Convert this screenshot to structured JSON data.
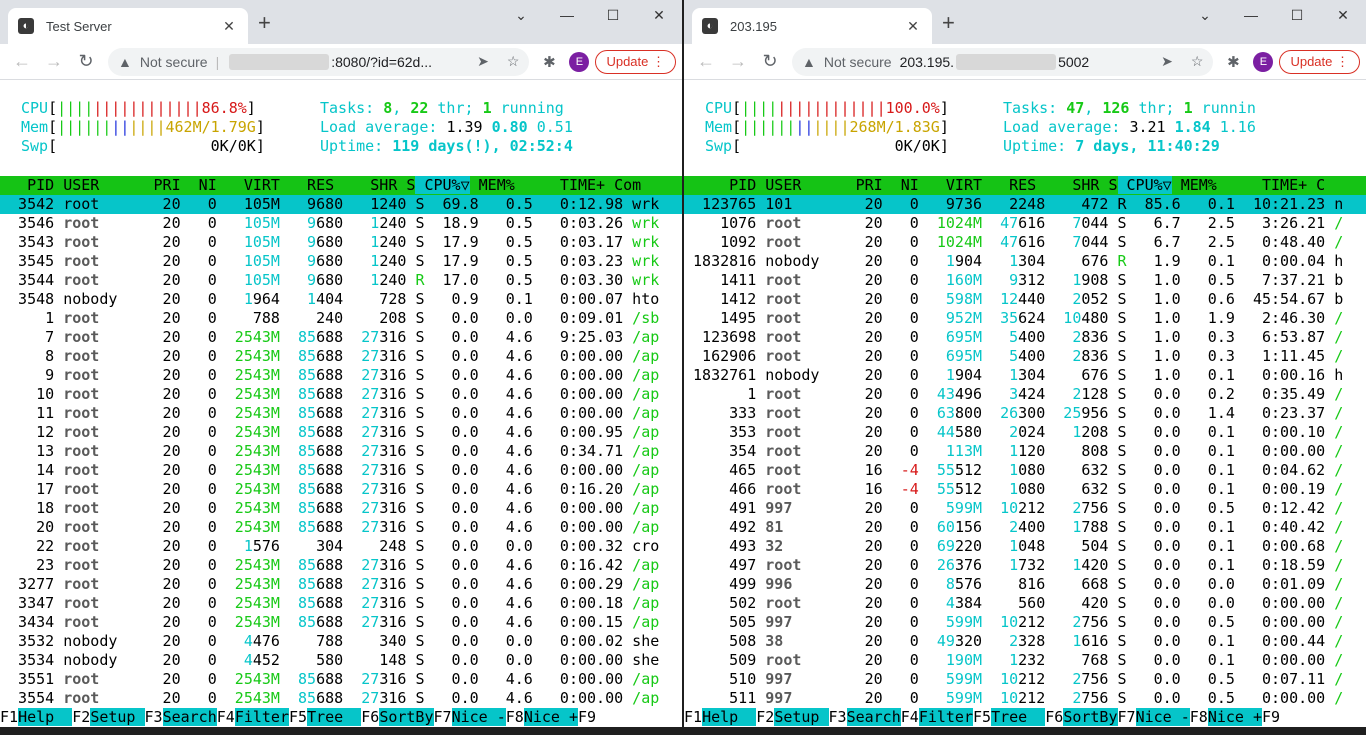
{
  "windows": [
    {
      "tab_title": "Test Server",
      "url_suffix": ":8080/?id=62d...",
      "not_secure": "Not secure",
      "update_label": "Update",
      "avatar": "E",
      "meters": {
        "cpu_label": "CPU",
        "cpu_bar": "||||||||||||||||",
        "cpu_val": "86.8%",
        "mem_label": "Mem",
        "mem_bar": "||||||||||||",
        "mem_val": "462M/1.79G",
        "swp_label": "Swp",
        "swp_val": "0K/0K",
        "tasks": "Tasks: ",
        "tasks_n": "8",
        "thr_n": "22",
        "running_n": "1",
        "tasks_rest": " thr; ",
        "running_word": " running",
        "load_label": "Load average: ",
        "load1": "1.39",
        "load5": "0.80",
        "load15": "0.51",
        "uptime_label": "Uptime: ",
        "uptime_val": "119 days(!), 02:52:4"
      },
      "columns": [
        "  PID",
        "USER     ",
        "  PRI",
        "  NI",
        "  VIRT",
        "   RES",
        "   SHR",
        "S",
        "CPU%▽",
        "MEM%",
        "   TIME+  ",
        "Com"
      ],
      "rows": [
        [
          "3542",
          "root",
          "20",
          "0",
          "105M",
          "9680",
          "1240",
          "S",
          "69.8",
          "0.5",
          "0:12.98",
          "wrk"
        ],
        [
          "3546",
          "root",
          "20",
          "0",
          "105M",
          "9680",
          "1240",
          "S",
          "18.9",
          "0.5",
          "0:03.26",
          "wrk"
        ],
        [
          "3543",
          "root",
          "20",
          "0",
          "105M",
          "9680",
          "1240",
          "S",
          "17.9",
          "0.5",
          "0:03.17",
          "wrk"
        ],
        [
          "3545",
          "root",
          "20",
          "0",
          "105M",
          "9680",
          "1240",
          "S",
          "17.9",
          "0.5",
          "0:03.23",
          "wrk"
        ],
        [
          "3544",
          "root",
          "20",
          "0",
          "105M",
          "9680",
          "1240",
          "R",
          "17.0",
          "0.5",
          "0:03.30",
          "wrk"
        ],
        [
          "3548",
          "nobody",
          "20",
          "0",
          "1964",
          "1404",
          "728",
          "S",
          "0.9",
          "0.1",
          "0:00.07",
          "hto"
        ],
        [
          "1",
          "root",
          "20",
          "0",
          "788",
          "240",
          "208",
          "S",
          "0.0",
          "0.0",
          "0:09.01",
          "/sb"
        ],
        [
          "7",
          "root",
          "20",
          "0",
          "2543M",
          "85688",
          "27316",
          "S",
          "0.0",
          "4.6",
          "9:25.03",
          "/ap"
        ],
        [
          "8",
          "root",
          "20",
          "0",
          "2543M",
          "85688",
          "27316",
          "S",
          "0.0",
          "4.6",
          "0:00.00",
          "/ap"
        ],
        [
          "9",
          "root",
          "20",
          "0",
          "2543M",
          "85688",
          "27316",
          "S",
          "0.0",
          "4.6",
          "0:00.00",
          "/ap"
        ],
        [
          "10",
          "root",
          "20",
          "0",
          "2543M",
          "85688",
          "27316",
          "S",
          "0.0",
          "4.6",
          "0:00.00",
          "/ap"
        ],
        [
          "11",
          "root",
          "20",
          "0",
          "2543M",
          "85688",
          "27316",
          "S",
          "0.0",
          "4.6",
          "0:00.00",
          "/ap"
        ],
        [
          "12",
          "root",
          "20",
          "0",
          "2543M",
          "85688",
          "27316",
          "S",
          "0.0",
          "4.6",
          "0:00.95",
          "/ap"
        ],
        [
          "13",
          "root",
          "20",
          "0",
          "2543M",
          "85688",
          "27316",
          "S",
          "0.0",
          "4.6",
          "0:34.71",
          "/ap"
        ],
        [
          "14",
          "root",
          "20",
          "0",
          "2543M",
          "85688",
          "27316",
          "S",
          "0.0",
          "4.6",
          "0:00.00",
          "/ap"
        ],
        [
          "17",
          "root",
          "20",
          "0",
          "2543M",
          "85688",
          "27316",
          "S",
          "0.0",
          "4.6",
          "0:16.20",
          "/ap"
        ],
        [
          "18",
          "root",
          "20",
          "0",
          "2543M",
          "85688",
          "27316",
          "S",
          "0.0",
          "4.6",
          "0:00.00",
          "/ap"
        ],
        [
          "20",
          "root",
          "20",
          "0",
          "2543M",
          "85688",
          "27316",
          "S",
          "0.0",
          "4.6",
          "0:00.00",
          "/ap"
        ],
        [
          "22",
          "root",
          "20",
          "0",
          "1576",
          "304",
          "248",
          "S",
          "0.0",
          "0.0",
          "0:00.32",
          "cro"
        ],
        [
          "23",
          "root",
          "20",
          "0",
          "2543M",
          "85688",
          "27316",
          "S",
          "0.0",
          "4.6",
          "0:16.42",
          "/ap"
        ],
        [
          "3277",
          "root",
          "20",
          "0",
          "2543M",
          "85688",
          "27316",
          "S",
          "0.0",
          "4.6",
          "0:00.29",
          "/ap"
        ],
        [
          "3347",
          "root",
          "20",
          "0",
          "2543M",
          "85688",
          "27316",
          "S",
          "0.0",
          "4.6",
          "0:00.18",
          "/ap"
        ],
        [
          "3434",
          "root",
          "20",
          "0",
          "2543M",
          "85688",
          "27316",
          "S",
          "0.0",
          "4.6",
          "0:00.15",
          "/ap"
        ],
        [
          "3532",
          "nobody",
          "20",
          "0",
          "4476",
          "788",
          "340",
          "S",
          "0.0",
          "0.0",
          "0:00.02",
          "she"
        ],
        [
          "3534",
          "nobody",
          "20",
          "0",
          "4452",
          "580",
          "148",
          "S",
          "0.0",
          "0.0",
          "0:00.00",
          "she"
        ],
        [
          "3551",
          "root",
          "20",
          "0",
          "2543M",
          "85688",
          "27316",
          "S",
          "0.0",
          "4.6",
          "0:00.00",
          "/ap"
        ],
        [
          "3554",
          "root",
          "20",
          "0",
          "2543M",
          "85688",
          "27316",
          "S",
          "0.0",
          "4.6",
          "0:00.00",
          "/ap"
        ]
      ]
    },
    {
      "tab_title": "203.195",
      "url_suffix": "5002",
      "url_prefix": "203.195.",
      "not_secure": "Not secure",
      "update_label": "Update",
      "avatar": "E",
      "meters": {
        "cpu_label": "CPU",
        "cpu_bar": "||||||||||||||||",
        "cpu_val": "100.0%",
        "mem_label": "Mem",
        "mem_bar": "||||||||||||",
        "mem_val": "268M/1.83G",
        "swp_label": "Swp",
        "swp_val": "0K/0K",
        "tasks": "Tasks: ",
        "tasks_n": "47",
        "thr_n": "126",
        "running_n": "1",
        "tasks_rest": " thr; ",
        "running_word": " runnin",
        "load_label": "Load average: ",
        "load1": "3.21",
        "load5": "1.84",
        "load15": "1.16",
        "uptime_label": "Uptime: ",
        "uptime_val": "7 days, 11:40:29"
      },
      "columns": [
        "    PID",
        "USER     ",
        "  PRI",
        "  NI",
        "  VIRT",
        "   RES",
        "   SHR",
        "S",
        "CPU%▽",
        "MEM%",
        "   TIME+  ",
        "C"
      ],
      "rows": [
        [
          "123765",
          "101",
          "20",
          "0",
          "9736",
          "2248",
          "472",
          "R",
          "85.6",
          "0.1",
          "10:21.23",
          "n"
        ],
        [
          "1076",
          "root",
          "20",
          "0",
          "1024M",
          "47616",
          "7044",
          "S",
          "6.7",
          "2.5",
          "3:26.21",
          "/"
        ],
        [
          "1092",
          "root",
          "20",
          "0",
          "1024M",
          "47616",
          "7044",
          "S",
          "6.7",
          "2.5",
          "0:48.40",
          "/"
        ],
        [
          "1832816",
          "nobody",
          "20",
          "0",
          "1904",
          "1304",
          "676",
          "R",
          "1.9",
          "0.1",
          "0:00.04",
          "h"
        ],
        [
          "1411",
          "root",
          "20",
          "0",
          "160M",
          "9312",
          "1908",
          "S",
          "1.0",
          "0.5",
          "7:37.21",
          "b"
        ],
        [
          "1412",
          "root",
          "20",
          "0",
          "598M",
          "12440",
          "2052",
          "S",
          "1.0",
          "0.6",
          "45:54.67",
          "b"
        ],
        [
          "1495",
          "root",
          "20",
          "0",
          "952M",
          "35624",
          "10480",
          "S",
          "1.0",
          "1.9",
          "2:46.30",
          "/"
        ],
        [
          "123698",
          "root",
          "20",
          "0",
          "695M",
          "5400",
          "2836",
          "S",
          "1.0",
          "0.3",
          "6:53.87",
          "/"
        ],
        [
          "162906",
          "root",
          "20",
          "0",
          "695M",
          "5400",
          "2836",
          "S",
          "1.0",
          "0.3",
          "1:11.45",
          "/"
        ],
        [
          "1832761",
          "nobody",
          "20",
          "0",
          "1904",
          "1304",
          "676",
          "S",
          "1.0",
          "0.1",
          "0:00.16",
          "h"
        ],
        [
          "1",
          "root",
          "20",
          "0",
          "43496",
          "3424",
          "2128",
          "S",
          "0.0",
          "0.2",
          "0:35.49",
          "/"
        ],
        [
          "333",
          "root",
          "20",
          "0",
          "63800",
          "26300",
          "25956",
          "S",
          "0.0",
          "1.4",
          "0:23.37",
          "/"
        ],
        [
          "353",
          "root",
          "20",
          "0",
          "44580",
          "2024",
          "1208",
          "S",
          "0.0",
          "0.1",
          "0:00.10",
          "/"
        ],
        [
          "354",
          "root",
          "20",
          "0",
          "113M",
          "1120",
          "808",
          "S",
          "0.0",
          "0.1",
          "0:00.00",
          "/"
        ],
        [
          "465",
          "root",
          "16",
          "-4",
          "55512",
          "1080",
          "632",
          "S",
          "0.0",
          "0.1",
          "0:04.62",
          "/"
        ],
        [
          "466",
          "root",
          "16",
          "-4",
          "55512",
          "1080",
          "632",
          "S",
          "0.0",
          "0.1",
          "0:00.19",
          "/"
        ],
        [
          "491",
          "997",
          "20",
          "0",
          "599M",
          "10212",
          "2756",
          "S",
          "0.0",
          "0.5",
          "0:12.42",
          "/"
        ],
        [
          "492",
          "81",
          "20",
          "0",
          "60156",
          "2400",
          "1788",
          "S",
          "0.0",
          "0.1",
          "0:40.42",
          "/"
        ],
        [
          "493",
          "32",
          "20",
          "0",
          "69220",
          "1048",
          "504",
          "S",
          "0.0",
          "0.1",
          "0:00.68",
          "/"
        ],
        [
          "497",
          "root",
          "20",
          "0",
          "26376",
          "1732",
          "1420",
          "S",
          "0.0",
          "0.1",
          "0:18.59",
          "/"
        ],
        [
          "499",
          "996",
          "20",
          "0",
          "8576",
          "816",
          "668",
          "S",
          "0.0",
          "0.0",
          "0:01.09",
          "/"
        ],
        [
          "502",
          "root",
          "20",
          "0",
          "4384",
          "560",
          "420",
          "S",
          "0.0",
          "0.0",
          "0:00.00",
          "/"
        ],
        [
          "505",
          "997",
          "20",
          "0",
          "599M",
          "10212",
          "2756",
          "S",
          "0.0",
          "0.5",
          "0:00.00",
          "/"
        ],
        [
          "508",
          "38",
          "20",
          "0",
          "49320",
          "2328",
          "1616",
          "S",
          "0.0",
          "0.1",
          "0:00.44",
          "/"
        ],
        [
          "509",
          "root",
          "20",
          "0",
          "190M",
          "1232",
          "768",
          "S",
          "0.0",
          "0.1",
          "0:00.00",
          "/"
        ],
        [
          "510",
          "997",
          "20",
          "0",
          "599M",
          "10212",
          "2756",
          "S",
          "0.0",
          "0.5",
          "0:07.11",
          "/"
        ],
        [
          "511",
          "997",
          "20",
          "0",
          "599M",
          "10212",
          "2756",
          "S",
          "0.0",
          "0.5",
          "0:00.00",
          "/"
        ]
      ]
    }
  ],
  "fkeys": [
    [
      "F1",
      "Help  "
    ],
    [
      "F2",
      "Setup "
    ],
    [
      "F3",
      "Search"
    ],
    [
      "F4",
      "Filter"
    ],
    [
      "F5",
      "Tree  "
    ],
    [
      "F6",
      "SortBy"
    ],
    [
      "F7",
      "Nice -"
    ],
    [
      "F8",
      "Nice +"
    ],
    [
      "F9",
      ""
    ]
  ]
}
